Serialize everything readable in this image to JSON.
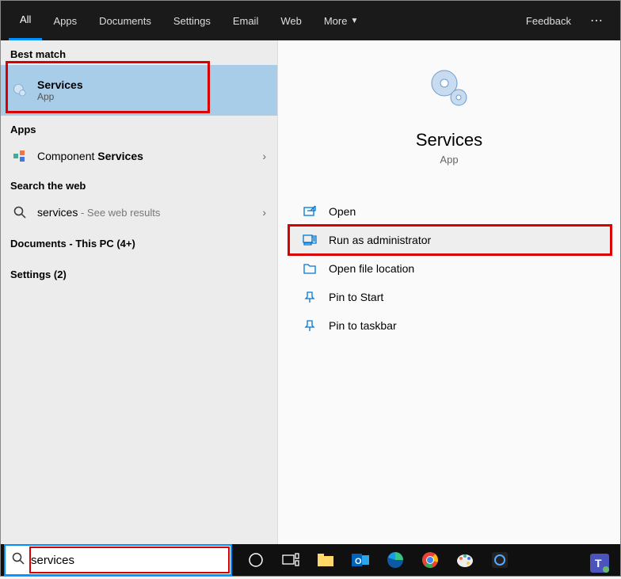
{
  "tabs": [
    "All",
    "Apps",
    "Documents",
    "Settings",
    "Email",
    "Web",
    "More"
  ],
  "feedback": "Feedback",
  "sections": {
    "best_match": "Best match",
    "apps": "Apps",
    "search_web": "Search the web"
  },
  "best_result": {
    "title": "Services",
    "sub": "App"
  },
  "app_result": {
    "prefix": "Component ",
    "bold": "Services"
  },
  "web_result": {
    "query": "services",
    "hint": " - See web results"
  },
  "documents_line": "Documents - This PC (4+)",
  "settings_line": "Settings (2)",
  "preview": {
    "title": "Services",
    "sub": "App"
  },
  "actions": {
    "open": "Open",
    "run_admin": "Run as administrator",
    "open_loc": "Open file location",
    "pin_start": "Pin to Start",
    "pin_taskbar": "Pin to taskbar"
  },
  "search_value": "services"
}
